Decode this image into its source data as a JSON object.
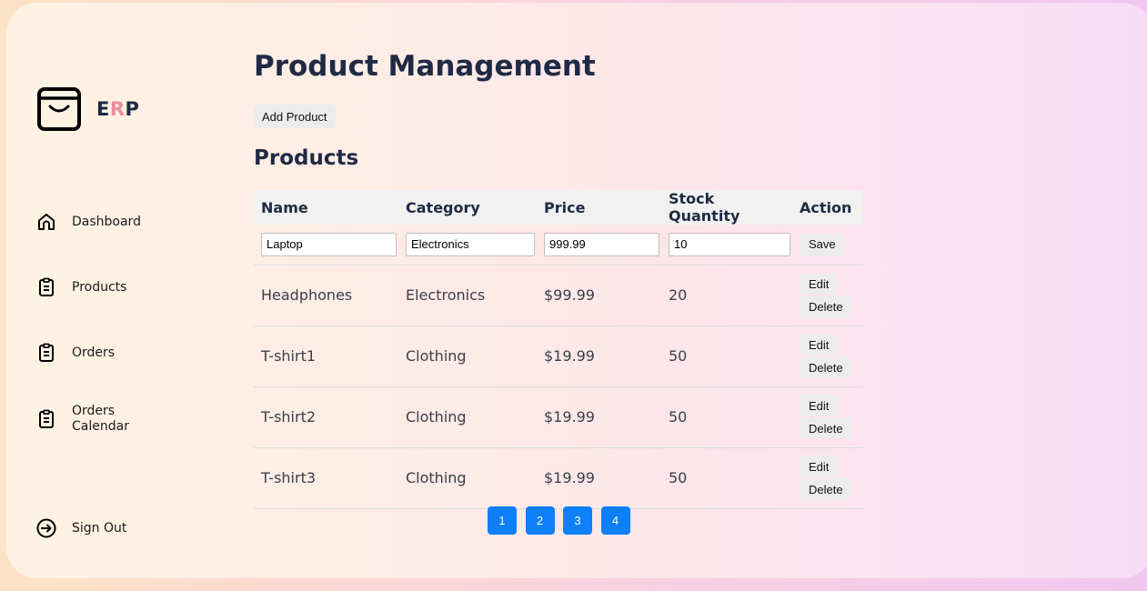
{
  "brand": {
    "prefix": "E",
    "accent": "R",
    "suffix": "P",
    "accent_color": "#f08ca0"
  },
  "sidebar": {
    "items": [
      {
        "label": "Dashboard",
        "icon": "home-icon"
      },
      {
        "label": "Products",
        "icon": "clipboard-icon"
      },
      {
        "label": "Orders",
        "icon": "clipboard-icon"
      },
      {
        "label": "Orders Calendar",
        "icon": "clipboard-icon"
      }
    ],
    "signout": {
      "label": "Sign Out",
      "icon": "sign-out-icon"
    }
  },
  "main": {
    "title": "Product Management",
    "add_button": "Add Product",
    "section_title": "Products",
    "columns": [
      "Name",
      "Category",
      "Price",
      "Stock Quantity",
      "Action"
    ],
    "edit_row": {
      "name": "Laptop",
      "category": "Electronics",
      "price": "999.99",
      "stock": "10",
      "save_label": "Save"
    },
    "rows": [
      {
        "name": "Headphones",
        "category": "Electronics",
        "price": "$99.99",
        "stock": "20"
      },
      {
        "name": "T-shirt1",
        "category": "Clothing",
        "price": "$19.99",
        "stock": "50"
      },
      {
        "name": "T-shirt2",
        "category": "Clothing",
        "price": "$19.99",
        "stock": "50"
      },
      {
        "name": "T-shirt3",
        "category": "Clothing",
        "price": "$19.99",
        "stock": "50"
      }
    ],
    "edit_label": "Edit",
    "delete_label": "Delete",
    "pages": [
      "1",
      "2",
      "3",
      "4"
    ],
    "pager_color": "#0d7ff9"
  }
}
